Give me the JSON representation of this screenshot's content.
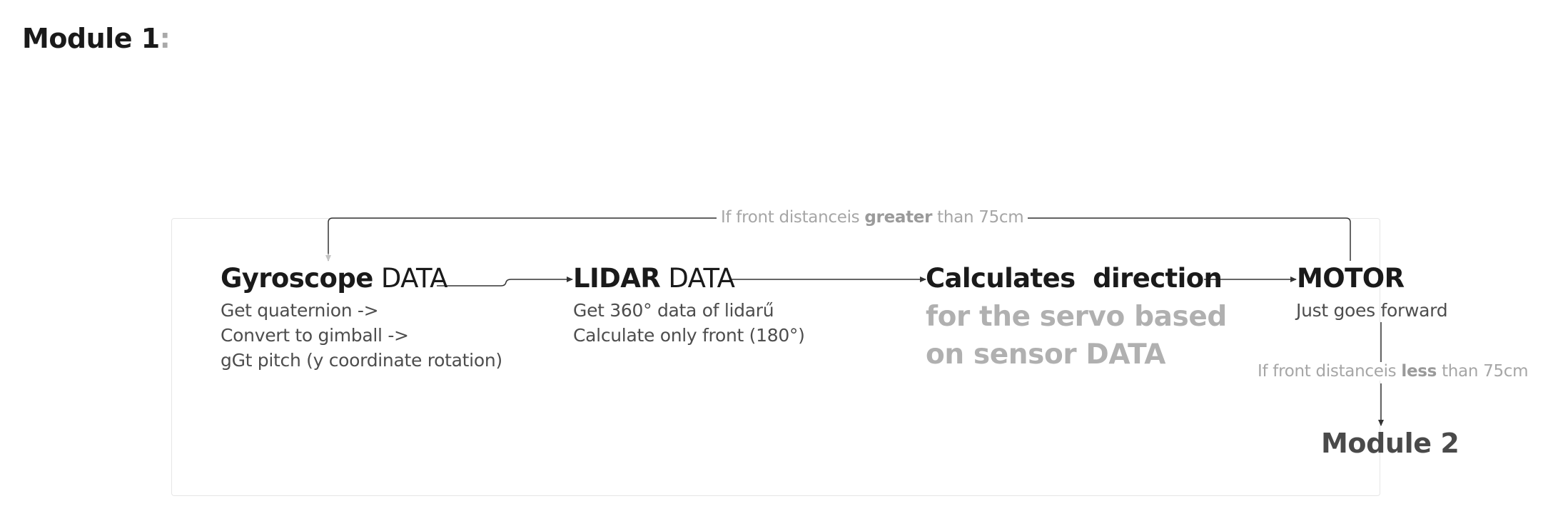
{
  "page": {
    "title": "Module 1",
    "title_suffix": ":"
  },
  "colors": {
    "text_dark": "#1a1a1a",
    "text_muted": "#4d4d4d",
    "text_grey": "#b0b0b0",
    "edge": "#333333",
    "edge_light": "#c4c4c4",
    "frame": "#e6e6e6"
  },
  "nodes": {
    "gyroscope": {
      "title_bold": "Gyroscope",
      "title_rest": "DATA",
      "lines": [
        "Get quaternion ->",
        "Convert to gimball ->",
        "gGt pitch (y coordinate rotation)"
      ]
    },
    "lidar": {
      "title_bold": "LIDAR",
      "title_rest": "DATA",
      "lines": [
        "Get 360° data of lidarű",
        "Calculate only front (180°)"
      ]
    },
    "calculates": {
      "title": "Calculates  direction",
      "subtitle_lines": [
        "for the servo based",
        "on sensor DATA"
      ]
    },
    "motor": {
      "title": "MOTOR",
      "lines": [
        "Just goes forward"
      ]
    },
    "module2": {
      "title": "Module 2"
    }
  },
  "edges": {
    "greater": {
      "prefix": "If front distanceis",
      "emphasis": "greater",
      "suffix": "than 75cm"
    },
    "less": {
      "prefix": "If front distanceis",
      "emphasis": "less",
      "suffix": "than 75cm"
    }
  }
}
